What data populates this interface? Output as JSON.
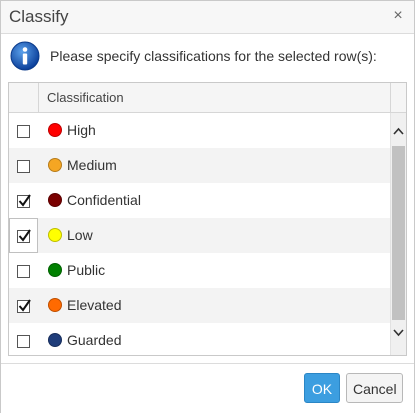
{
  "dialog": {
    "title": "Classify",
    "close_glyph": "×",
    "close_icon": "close-icon",
    "info_icon": "info-icon",
    "message": "Please specify classifications for the selected row(s):"
  },
  "grid": {
    "header": "Classification",
    "rows": [
      {
        "label": "High",
        "color": "#ff0000",
        "checked": false
      },
      {
        "label": "Medium",
        "color": "#f5a623",
        "checked": false
      },
      {
        "label": "Confidential",
        "color": "#7a0000",
        "checked": true
      },
      {
        "label": "Low",
        "color": "#ffff00",
        "checked": true
      },
      {
        "label": "Public",
        "color": "#008000",
        "checked": false
      },
      {
        "label": "Elevated",
        "color": "#ff6a00",
        "checked": true
      },
      {
        "label": "Guarded",
        "color": "#1f3d7a",
        "checked": false
      }
    ],
    "scroll_up_glyph": "^",
    "scroll_down_glyph": "v"
  },
  "buttons": {
    "ok_label": "OK",
    "cancel_label": "Cancel"
  },
  "colors": {
    "accent": "#3c9ee0",
    "info_blue": "#1a5fb4"
  }
}
